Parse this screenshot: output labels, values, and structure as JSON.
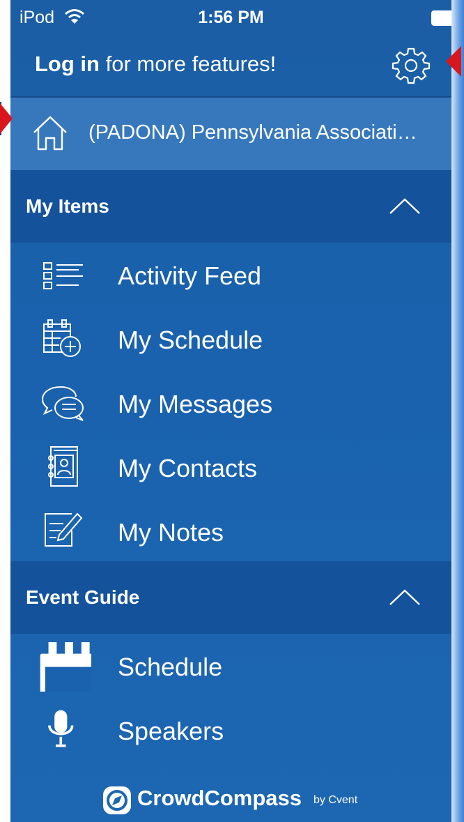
{
  "status_bar": {
    "carrier": "iPod",
    "time": "1:56 PM",
    "icons": [
      "wifi-icon",
      "battery-icon"
    ]
  },
  "header": {
    "login_bold": "Log in",
    "login_rest": " for more features!",
    "settings_icon": "gear-icon"
  },
  "event": {
    "name": "(PADONA) Pennsylvania Associati…",
    "icon": "home-icon"
  },
  "sections": {
    "my_items": {
      "title": "My Items",
      "items": [
        {
          "label": "Activity Feed",
          "icon": "activity-feed-icon"
        },
        {
          "label": "My Schedule",
          "icon": "calendar-add-icon"
        },
        {
          "label": "My Messages",
          "icon": "chat-bubbles-icon"
        },
        {
          "label": "My Contacts",
          "icon": "address-book-icon"
        },
        {
          "label": "My Notes",
          "icon": "note-pencil-icon"
        }
      ]
    },
    "event_guide": {
      "title": "Event Guide",
      "items": [
        {
          "label": "Schedule",
          "icon": "calendar-icon"
        },
        {
          "label": "Speakers",
          "icon": "microphone-icon"
        }
      ]
    }
  },
  "footer": {
    "brand": "CrowdCompass",
    "by": "by Cvent"
  },
  "colors": {
    "background": "#1a62ae",
    "section_header": "#14529b",
    "event_row": "#3778bd",
    "marker": "#d9161c"
  }
}
